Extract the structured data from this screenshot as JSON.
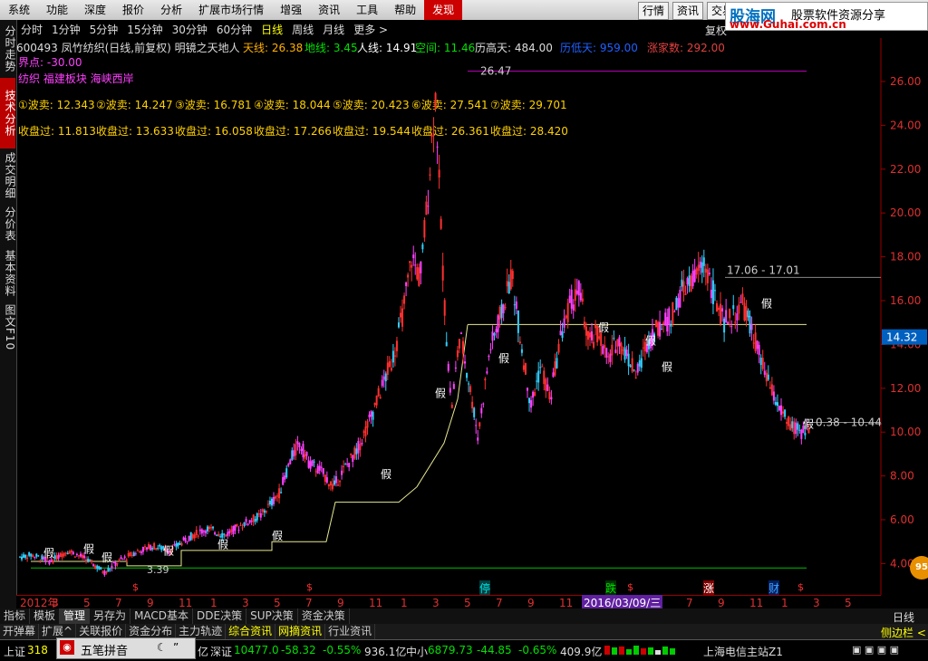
{
  "menu": [
    "系统",
    "功能",
    "深度",
    "报价",
    "分析",
    "扩展市场行情",
    "增强",
    "资讯",
    "工具",
    "帮助",
    "发现"
  ],
  "menu_right": [
    "行情",
    "资讯",
    "交易"
  ],
  "logo": {
    "brand": "股海网",
    "tagline": "股票软件资源分享",
    "url": "www.Guhai.com.cn"
  },
  "left_tabs": [
    "分时走势",
    "技术分析",
    "成交明细",
    "分价表",
    "基本资料",
    "图文F10"
  ],
  "periods": [
    "分时",
    "1分钟",
    "5分钟",
    "15分钟",
    "30分钟",
    "60分钟",
    "日线",
    "周线",
    "月线",
    "更多 >"
  ],
  "fuquan": "复权",
  "stock": {
    "title": "600493 凤竹纺织(日线,前复权) 明镜之天地人",
    "tian": "天线: 26.38",
    "di": "地线: 3.45",
    "ren": "人线: 14.91",
    "kong": "空间: 11.46",
    "lsg": "历高天: 484.00",
    "lsd": "历低天: 959.00",
    "zjs": "涨家数: 292.00",
    "jiedian": "界点: -30.00"
  },
  "sectors": "纺织 福建板块 海峡西岸",
  "wave_sell": [
    "①波卖: 12.343",
    "②波卖: 14.247",
    "③波卖: 16.781",
    "④波卖: 18.044",
    "⑤波卖: 20.423",
    "⑥波卖: 27.541",
    "⑦波卖: 29.701"
  ],
  "close_over": [
    "收盘过: 11.813",
    "收盘过: 13.633",
    "收盘过: 16.058",
    "收盘过: 17.266",
    "收盘过: 19.544",
    "收盘过: 26.361",
    "收盘过: 28.420"
  ],
  "annot": {
    "peak": "26.47",
    "band": "17.06 - 17.01",
    "low": "0.38 - 10.44",
    "lowstart": "3.39",
    "fake": "假"
  },
  "chart_data": {
    "type": "candlestick",
    "ylim": [
      3.2,
      27
    ],
    "y_ticks": [
      26.0,
      24.0,
      22.0,
      20.0,
      18.0,
      16.0,
      14.0,
      12.0,
      10.0,
      8.0,
      6.0,
      4.0
    ],
    "current_price": "14.32",
    "x_ticks": [
      "2012年",
      "3",
      "5",
      "7",
      "9",
      "11",
      "1",
      "3",
      "5",
      "7",
      "9",
      "11",
      "1",
      "3",
      "5",
      "7",
      "9",
      "11",
      "1",
      "3",
      "5",
      "7",
      "9",
      "11",
      "1",
      "3",
      "5"
    ],
    "cursor_date": "2016/03/09/三",
    "tian_line": 26.47,
    "ren_line": 14.91,
    "green_line": 3.8,
    "markers": [
      "停",
      "跌",
      "涨",
      "财"
    ],
    "price_path": [
      [
        0,
        4.3
      ],
      [
        10,
        4.4
      ],
      [
        25,
        4.1
      ],
      [
        40,
        4.6
      ],
      [
        55,
        4.2
      ],
      [
        70,
        3.6
      ],
      [
        82,
        4.1
      ],
      [
        95,
        4.5
      ],
      [
        110,
        4.8
      ],
      [
        125,
        4.6
      ],
      [
        140,
        5.2
      ],
      [
        155,
        5.6
      ],
      [
        170,
        5.3
      ],
      [
        185,
        5.8
      ],
      [
        200,
        6.2
      ],
      [
        215,
        7.2
      ],
      [
        225,
        8.8
      ],
      [
        232,
        9.5
      ],
      [
        240,
        8.6
      ],
      [
        250,
        8.2
      ],
      [
        260,
        7.5
      ],
      [
        270,
        8.4
      ],
      [
        280,
        9.2
      ],
      [
        290,
        10.5
      ],
      [
        300,
        12.0
      ],
      [
        310,
        13.5
      ],
      [
        318,
        15.5
      ],
      [
        325,
        18.0
      ],
      [
        332,
        17.0
      ],
      [
        338,
        20.5
      ],
      [
        342,
        23.5
      ],
      [
        345,
        25.5
      ],
      [
        348,
        21.0
      ],
      [
        352,
        16.0
      ],
      [
        358,
        11.0
      ],
      [
        365,
        14.5
      ],
      [
        372,
        12.5
      ],
      [
        380,
        9.8
      ],
      [
        390,
        13.8
      ],
      [
        400,
        15.5
      ],
      [
        408,
        17.2
      ],
      [
        416,
        14.0
      ],
      [
        424,
        11.2
      ],
      [
        432,
        13.0
      ],
      [
        440,
        11.5
      ],
      [
        448,
        14.2
      ],
      [
        456,
        15.8
      ],
      [
        464,
        16.5
      ],
      [
        472,
        14.0
      ],
      [
        480,
        14.6
      ],
      [
        488,
        13.2
      ],
      [
        496,
        14.3
      ],
      [
        504,
        13.5
      ],
      [
        512,
        12.6
      ],
      [
        520,
        14.1
      ],
      [
        530,
        14.8
      ],
      [
        540,
        15.2
      ],
      [
        550,
        16.5
      ],
      [
        560,
        17.0
      ],
      [
        568,
        17.8
      ],
      [
        576,
        16.2
      ],
      [
        584,
        15.0
      ],
      [
        592,
        15.3
      ],
      [
        600,
        15.8
      ],
      [
        608,
        14.5
      ],
      [
        616,
        13.0
      ],
      [
        624,
        11.8
      ],
      [
        632,
        10.9
      ],
      [
        640,
        10.2
      ],
      [
        648,
        10.0
      ],
      [
        656,
        10.3
      ]
    ]
  },
  "bottom_tabs": [
    "指标",
    "模板",
    "管理",
    "另存为",
    "MACD基本",
    "DDE决策",
    "SUP决策",
    "资金决策"
  ],
  "bottom_right": "日线",
  "sub_tabs": [
    "开弹幕",
    "扩展^",
    "关联报价",
    "资金分布",
    "主力轨迹",
    "综合资讯",
    "网摘资讯",
    "行业资讯"
  ],
  "side_bar": "侧边栏 <",
  "ime": {
    "label": "五笔拼音",
    "moon": "☾",
    "punct": "”"
  },
  "status": {
    "sh_label": "上证",
    "sh_val": "318",
    "yi": "亿",
    "sz_label": "深证",
    "sz_val": "10477.0",
    "sz_chg": "-58.32",
    "sz_pct": "-0.55%",
    "sz_amt": "936.1亿",
    "zx_label": "中小",
    "zx_val": "6879.73",
    "zx_chg": "-44.85",
    "zx_pct": "-0.65%",
    "zx_amt": "409.9亿",
    "server": "上海电信主站Z1"
  },
  "badge": "95"
}
